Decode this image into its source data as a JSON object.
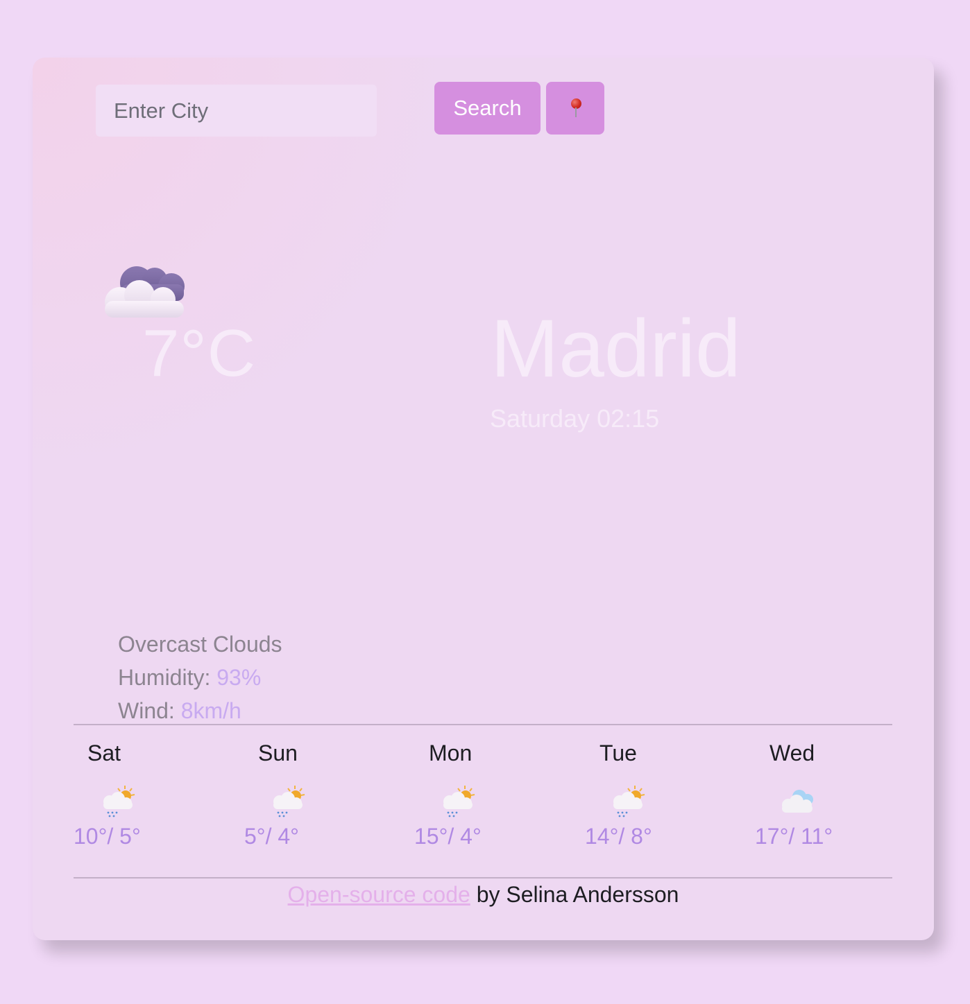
{
  "search": {
    "placeholder": "Enter City",
    "button_label": "Search",
    "location_icon": "round-pushpin-icon"
  },
  "current": {
    "icon": "overcast-clouds-icon",
    "temperature": "7°C",
    "city": "Madrid",
    "datetime": "Saturday 02:15",
    "description": "Overcast Clouds",
    "humidity_label": "Humidity: ",
    "humidity_value": "93%",
    "wind_label": "Wind: ",
    "wind_value": "8km/h"
  },
  "forecast": [
    {
      "day": "Sat",
      "icon": "sun-behind-rain-cloud-icon",
      "temps": "10°/ 5°"
    },
    {
      "day": "Sun",
      "icon": "sun-behind-rain-cloud-icon",
      "temps": "5°/ 4°"
    },
    {
      "day": "Mon",
      "icon": "sun-behind-rain-cloud-icon",
      "temps": "15°/ 4°"
    },
    {
      "day": "Tue",
      "icon": "sun-behind-rain-cloud-icon",
      "temps": "14°/ 8°"
    },
    {
      "day": "Wed",
      "icon": "cloud-icon",
      "temps": "17°/ 11°"
    }
  ],
  "footer": {
    "link_text": "Open-source code",
    "by_text": " by Selina Andersson"
  },
  "colors": {
    "background": "#f0d8f6",
    "accent_button": "#d58fdf",
    "forecast_temp": "#b089e3",
    "link": "#e4b0ea"
  }
}
